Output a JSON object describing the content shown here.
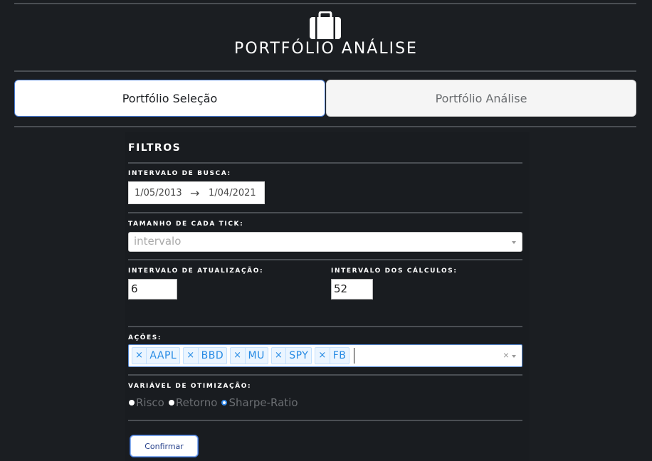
{
  "header": {
    "title": "PORTFÓLIO ANÁLISE",
    "logo_icon": "briefcase-icon"
  },
  "tabs": [
    {
      "label": "Portfólio Seleção",
      "active": true
    },
    {
      "label": "Portfólio Análise",
      "active": false
    }
  ],
  "filters": {
    "title": "FILTROS",
    "search_interval": {
      "label": "INTERVALO DE BUSCA:",
      "start": "1/05/2013",
      "arrow": "→",
      "end": "1/04/2021"
    },
    "tick_size": {
      "label": "TAMANHO DE CADA TICK:",
      "placeholder": "intervalo"
    },
    "update_interval": {
      "label": "INTERVALO DE ATUALIZAÇÃO:",
      "value": "6"
    },
    "calc_interval": {
      "label": "INTERVALO DOS CÁLCULOS:",
      "value": "52"
    },
    "stocks": {
      "label": "AÇÕES:",
      "items": [
        "AAPL",
        "BBD",
        "MU",
        "SPY",
        "FB"
      ],
      "remove_glyph": "×",
      "clear_glyph": "×"
    },
    "optimization": {
      "label": "VARIÁVEL DE OTIMIZAÇÃO:",
      "options": [
        "Risco",
        "Retorno",
        "Sharpe-Ratio"
      ],
      "selected": "Sharpe-Ratio"
    },
    "confirm_label": "Confirmar"
  },
  "colors": {
    "background": "#1b1e22",
    "accent": "#258ae4",
    "chip_bg": "#ebf5ff",
    "separator": "#4a4e53"
  }
}
